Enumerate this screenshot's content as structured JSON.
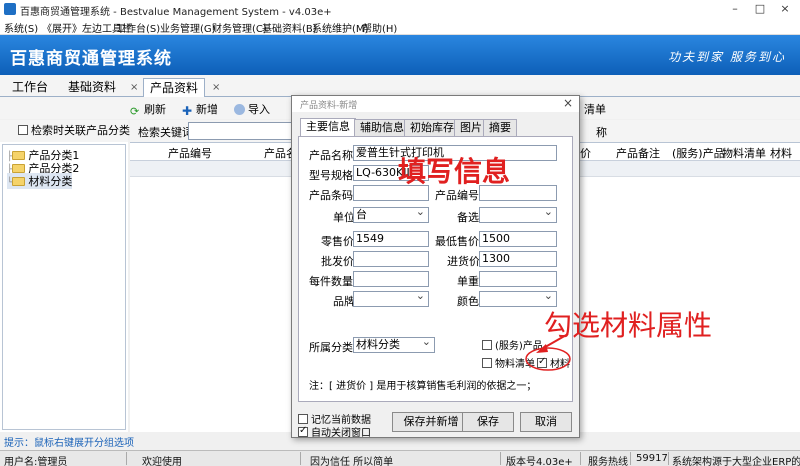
{
  "window": {
    "title": "百惠商贸通管理系统 - Bestvalue Management System - v4.03e+",
    "minimize": "–",
    "maximize": "□",
    "close": "×"
  },
  "menubar": [
    "系统(S)",
    "《展开》左边工具栏",
    "工作台(S)",
    "业务管理(G)",
    "财务管理(C)",
    "基础资料(B)",
    "系统维护(M)",
    "帮助(H)"
  ],
  "banner": {
    "title": "百惠商贸通管理系统",
    "slogan": "功夫到家 服务到心"
  },
  "tabs": [
    {
      "label": "工作台"
    },
    {
      "label": "基础资料"
    },
    {
      "label": "产品资料"
    }
  ],
  "tab_close": "×",
  "toolbar": {
    "refresh": "刷新",
    "add": "新增",
    "import": "导入",
    "bom": "清单"
  },
  "leftpanel": {
    "checkbox_label": "检索时关联产品分类",
    "tree": [
      "产品分类1",
      "产品分类2",
      "材料分类"
    ]
  },
  "search": {
    "label": "检索关键词"
  },
  "grid": {
    "columns": [
      "产品编号",
      "产品名",
      "价",
      "产品备注",
      "(服务)产品",
      "物料清单",
      "材料"
    ],
    "fragment": "称"
  },
  "hint": "提示：鼠标右键展开分组选项",
  "statusbar": [
    "用户名:管理员",
    "欢迎使用",
    "因为信任 所以简单",
    "版本号4.03e+",
    "服务热线",
    "59917",
    "系统架构源于大型企业ERP的"
  ],
  "dialog": {
    "title": "产品资料-新增",
    "close": "×",
    "tabs": [
      "主要信息",
      "辅助信息",
      "初始库存",
      "图片",
      "摘要"
    ],
    "fields": {
      "name_label": "产品名称",
      "name_value": "爱普生针式打印机",
      "model_label": "型号规格",
      "model_value": "LQ-630KII",
      "barcode_label": "产品条码",
      "code_label": "产品编号",
      "unit_label": "单位",
      "unit_value": "台",
      "spare_label": "备选",
      "retail_label": "零售价",
      "retail_value": "1549",
      "min_label": "最低售价",
      "min_value": "1500",
      "wholesale_label": "批发价",
      "purchase_label": "进货价",
      "purchase_value": "1300",
      "perpiece_label": "每件数量",
      "weight_label": "单重",
      "brand_label": "品牌",
      "color_label": "颜色",
      "category_label": "所属分类",
      "category_value": "材料分类"
    },
    "checks": {
      "service": "(服务)产品",
      "bom": "物料清单",
      "material": "材料"
    },
    "note": "注：[ 进货价 ] 是用于核算销售毛利润的依据之一；",
    "bottom_checks": {
      "remember": "记忆当前数据",
      "autoclose": "自动关闭窗口"
    },
    "buttons": {
      "save_new": "保存并新增",
      "save": "保存",
      "cancel": "取消"
    }
  },
  "annotations": {
    "fill_info": "填写信息",
    "check_material": "勾选材料属性"
  }
}
